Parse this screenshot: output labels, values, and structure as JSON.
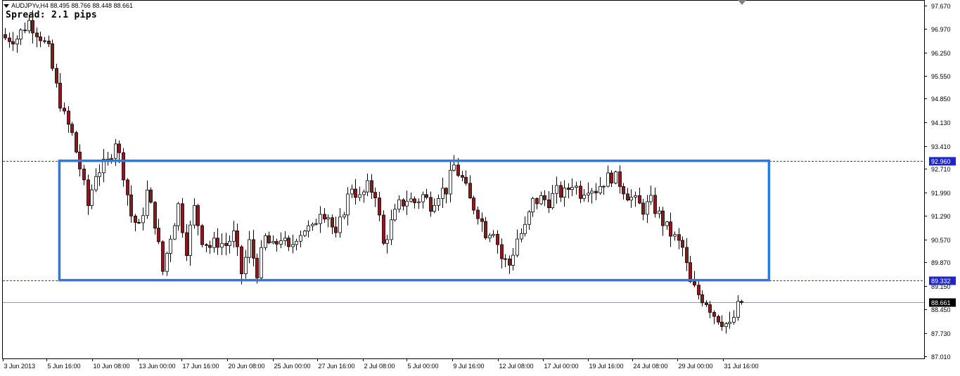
{
  "header": {
    "symbol_label": "AUDJPYv,H4",
    "ohlc": "88.495 88.766 88.448 88.661",
    "spread_label": "Spread: 2.1 pips"
  },
  "colors": {
    "bull_body": "#ffffff",
    "bear_body": "#8b1a1a",
    "wick": "#000000",
    "range_box": "#2b7bde",
    "hline_blue": "#2b3fbf",
    "bid_line": "#8c9aa8"
  },
  "chart_data": {
    "type": "candlestick",
    "symbol": "AUDJPYv",
    "timeframe": "H4",
    "ylim": [
      86.95,
      97.85
    ],
    "y_ticks": [
      "97.670",
      "96.970",
      "96.250",
      "95.550",
      "94.850",
      "94.130",
      "93.410",
      "92.710",
      "91.990",
      "91.290",
      "90.570",
      "89.870",
      "89.150",
      "88.450",
      "87.730",
      "87.010"
    ],
    "x_ticks": [
      "3 Jun 2013",
      "5 Jun 16:00",
      "10 Jun 08:00",
      "13 Jun 00:00",
      "17 Jun 16:00",
      "20 Jun 08:00",
      "25 Jun 00:00",
      "27 Jun 16:00",
      "2 Jul 08:00",
      "5 Jul 00:00",
      "9 Jul 16:00",
      "12 Jul 08:00",
      "17 Jul 00:00",
      "19 Jul 16:00",
      "24 Jul 08:00",
      "29 Jul 00:00",
      "31 Jul 16:00"
    ],
    "horizontal_lines": [
      {
        "price": 92.96,
        "label": "92.960",
        "style": "dashed"
      },
      {
        "price": 89.332,
        "label": "89.332",
        "style": "dashed"
      },
      {
        "price": 88.661,
        "label": "88.661",
        "style": "bid"
      }
    ],
    "range_box": {
      "upper": 92.96,
      "lower": 89.33
    },
    "close_path": [
      [
        0,
        96.7
      ],
      [
        3,
        96.7
      ],
      [
        6,
        97.2
      ],
      [
        9,
        96.75
      ],
      [
        11,
        96.3
      ],
      [
        13,
        95.2
      ],
      [
        15,
        94.3
      ],
      [
        17,
        93.75
      ],
      [
        19,
        92.75
      ],
      [
        21,
        91.6
      ],
      [
        23,
        92.6
      ],
      [
        26,
        92.9
      ],
      [
        28,
        93.6
      ],
      [
        30,
        92.6
      ],
      [
        32,
        91.3
      ],
      [
        34,
        90.9
      ],
      [
        36,
        92.0
      ],
      [
        38,
        91.1
      ],
      [
        40,
        89.6
      ],
      [
        42,
        90.7
      ],
      [
        44,
        91.6
      ],
      [
        46,
        90.3
      ],
      [
        48,
        91.5
      ],
      [
        50,
        90.6
      ],
      [
        52,
        90.35
      ],
      [
        54,
        90.5
      ],
      [
        56,
        90.4
      ],
      [
        58,
        90.7
      ],
      [
        60,
        89.55
      ],
      [
        62,
        90.45
      ],
      [
        64,
        89.6
      ],
      [
        66,
        90.6
      ],
      [
        68,
        90.3
      ],
      [
        70,
        90.65
      ],
      [
        72,
        90.2
      ],
      [
        74,
        90.7
      ],
      [
        76,
        90.9
      ],
      [
        78,
        90.85
      ],
      [
        80,
        91.5
      ],
      [
        82,
        91.3
      ],
      [
        84,
        90.6
      ],
      [
        86,
        91.5
      ],
      [
        88,
        92.2
      ],
      [
        90,
        91.8
      ],
      [
        92,
        92.15
      ],
      [
        94,
        92.0
      ],
      [
        96,
        90.4
      ],
      [
        98,
        91.05
      ],
      [
        100,
        91.6
      ],
      [
        102,
        91.8
      ],
      [
        104,
        91.7
      ],
      [
        106,
        91.9
      ],
      [
        108,
        91.65
      ],
      [
        110,
        92.0
      ],
      [
        112,
        92.1
      ],
      [
        114,
        92.8
      ],
      [
        116,
        92.4
      ],
      [
        118,
        91.75
      ],
      [
        120,
        91.4
      ],
      [
        122,
        90.8
      ],
      [
        124,
        90.9
      ],
      [
        126,
        90.0
      ],
      [
        128,
        89.8
      ],
      [
        130,
        90.6
      ],
      [
        132,
        90.9
      ],
      [
        134,
        91.7
      ],
      [
        136,
        91.8
      ],
      [
        138,
        91.75
      ],
      [
        140,
        92.0
      ],
      [
        142,
        91.95
      ],
      [
        144,
        92.3
      ],
      [
        146,
        92.0
      ],
      [
        148,
        92.2
      ],
      [
        150,
        92.1
      ],
      [
        152,
        92.35
      ],
      [
        154,
        92.5
      ],
      [
        156,
        92.3
      ],
      [
        158,
        91.95
      ],
      [
        160,
        91.7
      ],
      [
        162,
        91.5
      ],
      [
        164,
        91.7
      ],
      [
        166,
        91.3
      ],
      [
        168,
        90.9
      ],
      [
        170,
        90.6
      ],
      [
        172,
        90.3
      ],
      [
        174,
        89.2
      ],
      [
        176,
        88.9
      ],
      [
        178,
        88.7
      ],
      [
        180,
        88.3
      ],
      [
        182,
        88.1
      ],
      [
        184,
        87.9
      ],
      [
        186,
        88.5
      ],
      [
        187,
        88.66
      ]
    ]
  }
}
